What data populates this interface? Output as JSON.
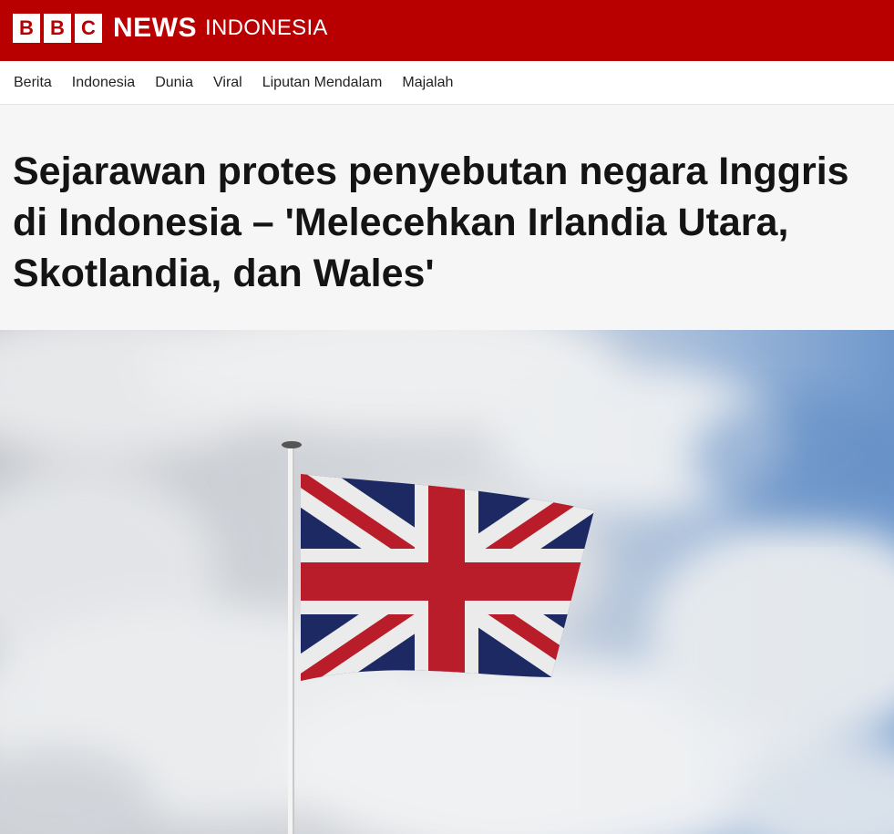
{
  "brand": {
    "bbc_letters": [
      "B",
      "B",
      "C"
    ],
    "news": "NEWS",
    "edition": "INDONESIA",
    "color": "#b80000"
  },
  "nav": {
    "items": [
      "Berita",
      "Indonesia",
      "Dunia",
      "Viral",
      "Liputan Mendalam",
      "Majalah"
    ]
  },
  "article": {
    "headline": "Sejarawan protes penyebutan negara Inggris di Indonesia – 'Melecehkan Irlandia Utara, Skotlandia, dan Wales'"
  },
  "hero_image": {
    "subject": "union-jack-flag-on-pole-against-cloudy-sky"
  }
}
